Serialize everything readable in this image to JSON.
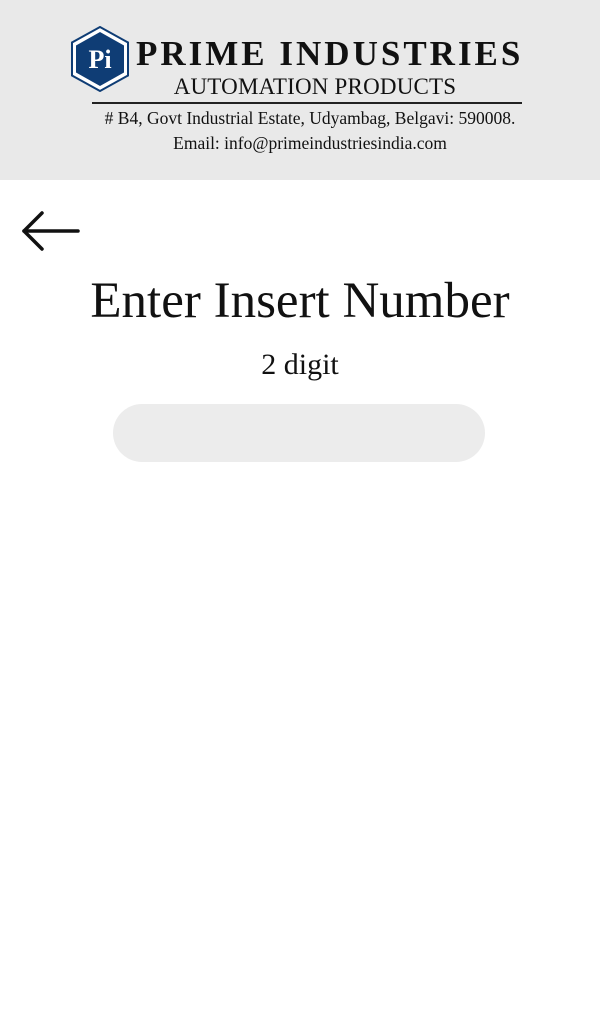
{
  "header": {
    "logo_text": "Pi",
    "company_name": "PRIME INDUSTRIES",
    "tagline": "AUTOMATION PRODUCTS",
    "address": "# B4, Govt Industrial Estate, Udyambag, Belgavi: 590008.",
    "email": "Email: info@primeindustriesindia.com",
    "brand_color": "#0f3d75"
  },
  "nav": {
    "back_icon": "arrow-left-icon"
  },
  "main": {
    "title": "Enter Insert Number",
    "subtitle": "2 digit",
    "input_value": "",
    "input_placeholder": ""
  }
}
